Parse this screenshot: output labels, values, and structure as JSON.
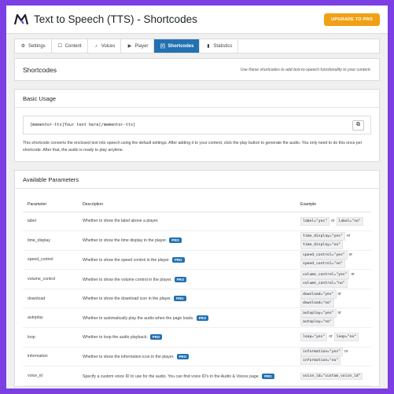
{
  "app": {
    "title": "Text to Speech (TTS) - Shortcodes",
    "upgrade_label": "UPGRADE TO PRO"
  },
  "tabs": [
    {
      "label": "Settings",
      "icon": "gear-icon",
      "glyph": "⚙"
    },
    {
      "label": "Content",
      "icon": "document-icon",
      "glyph": "☐"
    },
    {
      "label": "Voices",
      "icon": "microphone-icon",
      "glyph": "♪"
    },
    {
      "label": "Player",
      "icon": "play-icon",
      "glyph": "▶"
    },
    {
      "label": "Shortcodes",
      "icon": "code-icon",
      "glyph": "[/]"
    },
    {
      "label": "Statistics",
      "icon": "bar-chart-icon",
      "glyph": "▮"
    }
  ],
  "shortcodes_card": {
    "title": "Shortcodes",
    "subtitle": "Use these shortcodes to add text-to-speech functionality to your content."
  },
  "basic_usage": {
    "title": "Basic Usage",
    "code": "[mementor-tts]Your text here[/mementor-tts]",
    "copy_icon": "copy-icon",
    "description": "This shortcode converts the enclosed text into speech using the default settings. After adding it to your content, click the play button to generate the audio. You only need to do this once per shortcode. After that, the audio is ready to play anytime."
  },
  "parameters": {
    "title": "Available Parameters",
    "headers": {
      "parameter": "Parameter",
      "description": "Description",
      "example": "Example"
    },
    "pro_label": "PRO",
    "or_label": "or",
    "rows": [
      {
        "parameter": "label",
        "description": "Whether to show the label above a player.",
        "pro": false,
        "ex1": "label=\"yes\"",
        "ex2": "label=\"no\"",
        "inline": true
      },
      {
        "parameter": "time_display",
        "description": "Whether to show the time display in the player.",
        "pro": true,
        "ex1": "time_display=\"yes\"",
        "ex2": "time_display=\"no\"",
        "inline": false
      },
      {
        "parameter": "speed_control",
        "description": "Whether to show the speed control in the player.",
        "pro": true,
        "ex1": "speed_control=\"yes\"",
        "ex2": "speed_control=\"no\"",
        "inline": false
      },
      {
        "parameter": "volume_control",
        "description": "Whether to show the volume control in the player.",
        "pro": true,
        "ex1": "volume_control=\"yes\"",
        "ex2": "volume_control=\"no\"",
        "inline": false
      },
      {
        "parameter": "download",
        "description": "Whether to show the download icon in the player.",
        "pro": true,
        "ex1": "download=\"yes\"",
        "ex2": "download=\"no\"",
        "inline": false
      },
      {
        "parameter": "autoplay",
        "description": "Whether to automatically play the audio when the page loads.",
        "pro": true,
        "ex1": "autoplay=\"yes\"",
        "ex2": "autoplay=\"no\"",
        "inline": false
      },
      {
        "parameter": "loop",
        "description": "Whether to loop the audio playback.",
        "pro": true,
        "ex1": "loop=\"yes\"",
        "ex2": "loop=\"no\"",
        "inline": true
      },
      {
        "parameter": "information",
        "description": "Whether to show the information icon in the player.",
        "pro": true,
        "ex1": "information=\"yes\"",
        "ex2": "information=\"no\"",
        "inline": false
      },
      {
        "parameter": "voice_id",
        "description": "Specify a custom voice ID to use for the audio. You can find voice ID's in the Audio & Voices page.",
        "pro": true,
        "ex1": "voice_id=\"custom_voice_id\"",
        "ex2": "",
        "inline": true
      }
    ]
  },
  "colors": {
    "page_border": "#7b3fe4",
    "accent": "#2271b1",
    "upgrade": "#f0a015"
  }
}
